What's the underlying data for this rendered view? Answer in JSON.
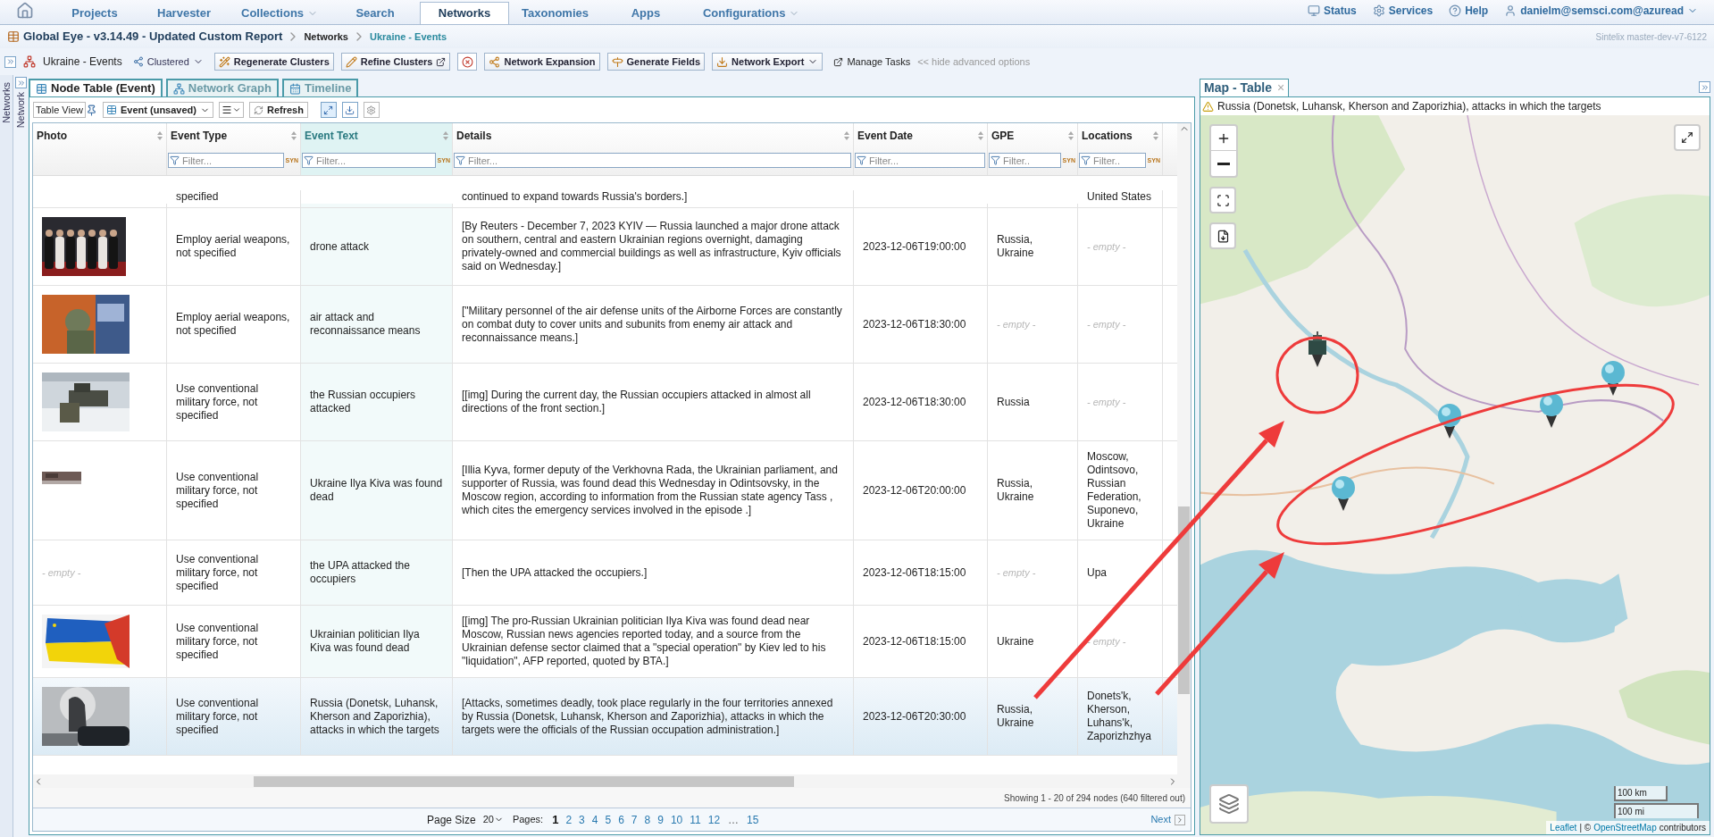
{
  "nav": {
    "tabs": [
      {
        "label": "Projects",
        "selected": false,
        "dropdown": false
      },
      {
        "label": "Harvester",
        "selected": false,
        "dropdown": false
      },
      {
        "label": "Collections",
        "selected": false,
        "dropdown": true
      },
      {
        "label": "Search",
        "selected": false,
        "dropdown": false
      },
      {
        "label": "Networks",
        "selected": true,
        "dropdown": false
      },
      {
        "label": "Taxonomies",
        "selected": false,
        "dropdown": false
      },
      {
        "label": "Apps",
        "selected": false,
        "dropdown": false
      },
      {
        "label": "Configurations",
        "selected": false,
        "dropdown": true
      }
    ],
    "links": [
      {
        "label": "Status",
        "kind": "status"
      },
      {
        "label": "Services",
        "kind": "services"
      },
      {
        "label": "Help",
        "kind": "help"
      },
      {
        "label": "danielm@semsci.com@azuread",
        "kind": "user"
      }
    ]
  },
  "breadcrumb": [
    "Global Eye - v3.14.49 - Updated Custom Report",
    "Networks",
    "Ukraine - Events"
  ],
  "version": "Sintelix master-dev-v7-6122",
  "toolbar": {
    "network": "Ukraine - Events",
    "mode": "Clustered",
    "buttons": [
      {
        "label": "Regenerate Clusters",
        "kind": "regenerate"
      },
      {
        "label": "Refine Clusters",
        "kind": "refine"
      },
      {
        "label": "Network Expansion",
        "kind": "expansion"
      },
      {
        "label": "Generate Fields",
        "kind": "fields"
      },
      {
        "label": "Network Export",
        "kind": "export"
      }
    ],
    "manage_tasks": "Manage Tasks",
    "hide_advanced": "<< hide advanced options"
  },
  "side_strips": [
    "Networks",
    "Network"
  ],
  "view_tabs": [
    {
      "label": "Node Table (Event)",
      "selected": true,
      "kind": "table"
    },
    {
      "label": "Network Graph",
      "selected": false,
      "kind": "graph"
    },
    {
      "label": "Timeline",
      "selected": false,
      "kind": "timeline"
    }
  ],
  "table_toolbar": {
    "view_label": "Table View",
    "view": "Event (unsaved)",
    "refresh": "Refresh"
  },
  "table": {
    "columns": [
      {
        "label": "Photo",
        "selected": false
      },
      {
        "label": "Event Type",
        "selected": false,
        "placeholder": "Filter...",
        "syn": "SYN"
      },
      {
        "label": "Event Text",
        "selected": true,
        "placeholder": "Filter...",
        "syn": "SYN"
      },
      {
        "label": "Details",
        "selected": false,
        "placeholder": "Filter..."
      },
      {
        "label": "Event Date",
        "selected": false,
        "placeholder": "Filter..."
      },
      {
        "label": "GPE",
        "selected": false,
        "placeholder": "Filter..",
        "syn": "SYN"
      },
      {
        "label": "Locations",
        "selected": false,
        "placeholder": "Filter..",
        "syn": "SYN"
      }
    ],
    "rows": [
      {
        "partial": true,
        "selected": false,
        "event_type": "specified",
        "details": "continued to expand towards Russia's borders.]",
        "locations": "United States"
      },
      {
        "partial": false,
        "selected": false,
        "event_type": "Employ aerial weapons, not specified",
        "event_text": "drone attack",
        "details": "[By Reuters - December 7, 2023 KYIV — Russia launched a major drone attack on southern, central and eastern Ukrainian regions overnight, damaging privately-owned and commercial buildings as well as infrastructure, Kyiv officials said on Wednesday.]",
        "date": "2023-12-06T19:00:00",
        "gpe": "Russia, Ukraine",
        "locations": {
          "empty": true,
          "text": "- empty -"
        }
      },
      {
        "partial": false,
        "selected": false,
        "event_type": "Employ aerial weapons, not specified",
        "event_text": "air attack and reconnaissance means",
        "details": "[\"Military personnel of the air defense units of the Airborne Forces are constantly on combat duty to cover units and subunits from enemy air attack and reconnaissance means.]",
        "date": "2023-12-06T18:30:00",
        "gpe": {
          "empty": true,
          "text": "- empty -"
        },
        "locations": {
          "empty": true,
          "text": "- empty -"
        }
      },
      {
        "partial": false,
        "selected": false,
        "event_type": "Use conventional military force, not specified",
        "event_text": "the Russian occupiers attacked",
        "details": "[[img] During the current day, the Russian occupiers attacked in almost all directions of the front section.]",
        "date": "2023-12-06T18:30:00",
        "gpe": "Russia",
        "locations": {
          "empty": true,
          "text": "- empty -"
        }
      },
      {
        "partial": false,
        "selected": false,
        "event_type": "Use conventional military force, not specified",
        "event_text": "Ukraine Ilya Kiva was found dead",
        "details": "[Illia Kyva, former deputy of the Verkhovna Rada, the Ukrainian parliament, and supporter of Russia, was found dead this Wednesday in Odintsovsky, in the Moscow region, according to information from the Russian state agency Tass , which cites the emergency services involved in the episode .]",
        "date": "2023-12-06T20:00:00",
        "gpe": "Russia, Ukraine",
        "locations": "Moscow, Odintsovo, Russian Federation, Suponevo, Ukraine"
      },
      {
        "partial": false,
        "selected": false,
        "photo": {
          "kind": "empty",
          "text": "- empty -"
        },
        "event_type": "Use conventional military force, not specified",
        "event_text": "the UPA attacked the occupiers",
        "details": "[Then the UPA attacked the occupiers.]",
        "date": "2023-12-06T18:15:00",
        "gpe": {
          "empty": true,
          "text": "- empty -"
        },
        "locations": "Upa"
      },
      {
        "partial": false,
        "selected": false,
        "event_type": "Use conventional military force, not specified",
        "event_text": "Ukrainian politician Ilya Kiva was found dead",
        "details": "[[img] The pro-Russian Ukrainian politician Ilya Kiva was found dead near Moscow, Russian news agencies reported today, and a source from the Ukrainian defense sector claimed that a \"special operation\" by Kiev led to his \"liquidation\", AFP reported, quoted by BTA.]",
        "date": "2023-12-06T18:15:00",
        "gpe": "Ukraine",
        "locations": {
          "empty": true,
          "text": "- empty -"
        }
      },
      {
        "partial": false,
        "selected": true,
        "event_type": "Use conventional military force, not specified",
        "event_text": "Russia (Donetsk, Luhansk, Kherson and Zaporizhia), attacks in which the targets",
        "details": "[Attacks, sometimes deadly, took place regularly in the four territories annexed by Russia (Donetsk, Luhansk, Kherson and Zaporizhia), attacks in which the targets were the officials of the Russian occupation administration.]",
        "date": "2023-12-06T20:30:00",
        "gpe": "Russia, Ukraine",
        "locations": "Donets'k, Kherson, Luhans'k, Zaporizhzhya"
      }
    ]
  },
  "status": "Showing 1 - 20 of 294 nodes (640 filtered out)",
  "pagination": {
    "page_size_label": "Page Size",
    "page_size": "20",
    "pages_label": "Pages:",
    "pages": [
      {
        "label": "1",
        "selected": true,
        "kind": "page"
      },
      {
        "label": "2",
        "selected": false,
        "kind": "page"
      },
      {
        "label": "3",
        "selected": false,
        "kind": "page"
      },
      {
        "label": "4",
        "selected": false,
        "kind": "page"
      },
      {
        "label": "5",
        "selected": false,
        "kind": "page"
      },
      {
        "label": "6",
        "selected": false,
        "kind": "page"
      },
      {
        "label": "7",
        "selected": false,
        "kind": "page"
      },
      {
        "label": "8",
        "selected": false,
        "kind": "page"
      },
      {
        "label": "9",
        "selected": false,
        "kind": "page"
      },
      {
        "label": "10",
        "selected": false,
        "kind": "page"
      },
      {
        "label": "11",
        "selected": false,
        "kind": "page"
      },
      {
        "label": "12",
        "selected": false,
        "kind": "page"
      },
      {
        "label": "…",
        "selected": false,
        "kind": "gap"
      },
      {
        "label": "15",
        "selected": false,
        "kind": "page"
      }
    ],
    "next": "Next"
  },
  "map_panel": {
    "tab": "Map - Table",
    "close": "×",
    "title": "Russia (Donetsk, Luhansk, Kherson and Zaporizhia), attacks in which the targets",
    "scale": [
      "100 km",
      "100 mi"
    ],
    "attribution": {
      "leaflet": "Leaflet",
      "separator": "| ©",
      "osm": "OpenStreetMap",
      "suffix": "contributors"
    }
  }
}
